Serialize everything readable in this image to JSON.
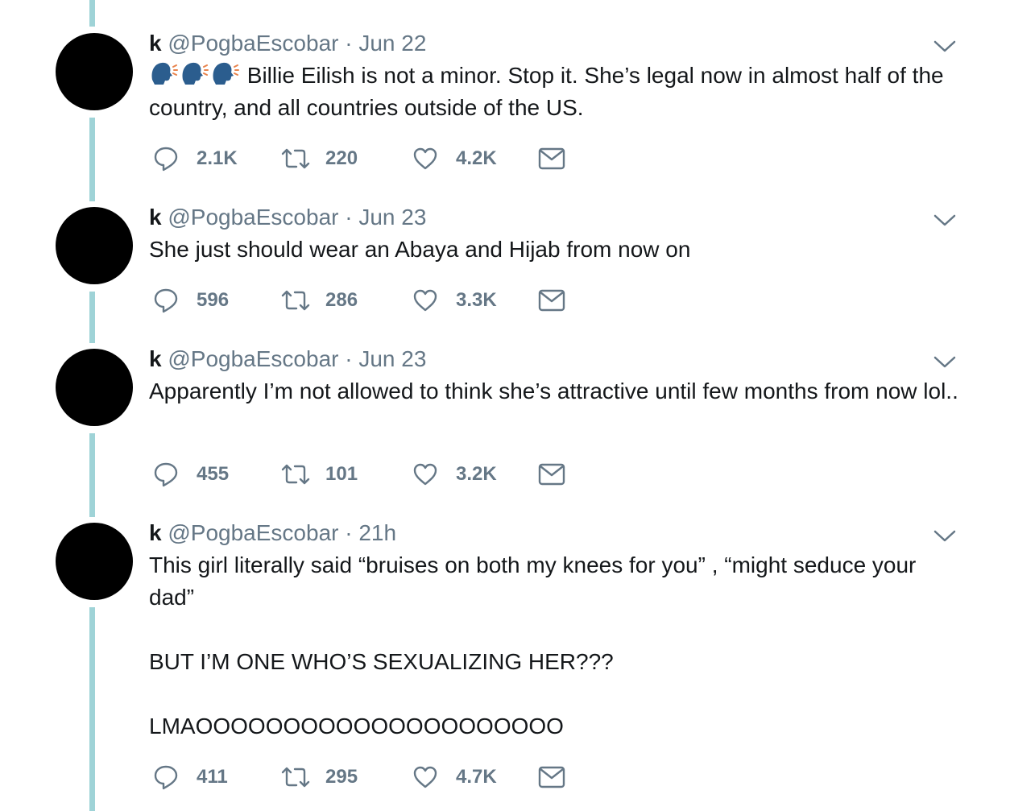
{
  "tweets": [
    {
      "name": "k",
      "handle": "@PogbaEscobar",
      "separator": "·",
      "time": "Jun 22",
      "emoji": [
        "speaking-head-emoji",
        "speaking-head-emoji",
        "speaking-head-emoji"
      ],
      "text": " Billie Eilish is not a minor. Stop it. She’s legal now in almost half of the country, and all countries outside of the US.",
      "replies": "2.1K",
      "retweets": "220",
      "likes": "4.2K"
    },
    {
      "name": "k",
      "handle": "@PogbaEscobar",
      "separator": "·",
      "time": "Jun 23",
      "text": "She just should wear an Abaya and Hijab from now on",
      "replies": "596",
      "retweets": "286",
      "likes": "3.3K"
    },
    {
      "name": "k",
      "handle": "@PogbaEscobar",
      "separator": "·",
      "time": "Jun 23",
      "text": "Apparently I’m not allowed to think she’s attractive until few months from now lol..",
      "replies": "455",
      "retweets": "101",
      "likes": "3.2K"
    },
    {
      "name": "k",
      "handle": "@PogbaEscobar",
      "separator": "·",
      "time": "21h",
      "text": "This girl literally said “bruises on both my knees for you” , “might seduce your dad”\n\nBUT I’M ONE WHO’S SEXUALIZING HER???\n\nLMAOOOOOOOOOOOOOOOOOOOOO",
      "replies": "411",
      "retweets": "295",
      "likes": "4.7K"
    }
  ],
  "colors": {
    "thread_line": "#9fd3d7",
    "secondary_text": "#657786",
    "primary_text": "#14171a"
  },
  "icons": [
    "reply-icon",
    "retweet-icon",
    "like-icon",
    "direct-message-icon",
    "chevron-down-icon"
  ]
}
